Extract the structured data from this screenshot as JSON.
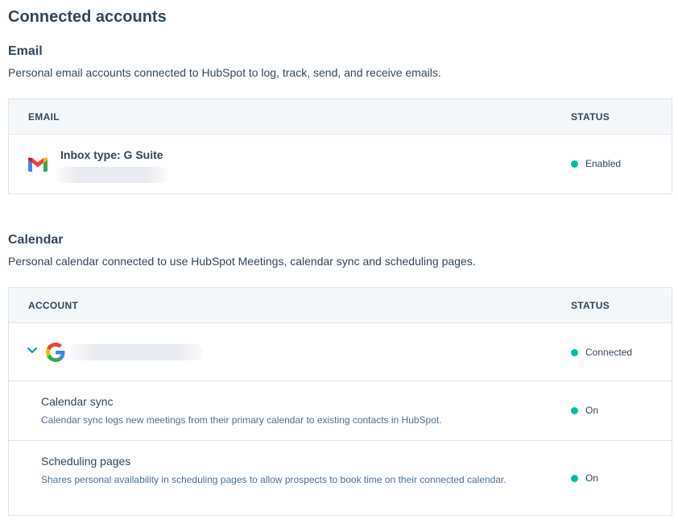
{
  "page": {
    "title": "Connected accounts"
  },
  "email_section": {
    "title": "Email",
    "description": "Personal email accounts connected to HubSpot to log, track, send, and receive emails.",
    "columns": {
      "email": "EMAIL",
      "status": "STATUS"
    },
    "rows": [
      {
        "icon": "gmail-icon",
        "inbox_type": "Inbox type: G Suite",
        "status": "Enabled",
        "status_color": "#00bda5"
      }
    ]
  },
  "calendar_section": {
    "title": "Calendar",
    "description": "Personal calendar connected to use HubSpot Meetings, calendar sync and scheduling pages.",
    "columns": {
      "account": "ACCOUNT",
      "status": "STATUS"
    },
    "account": {
      "icon": "google-icon",
      "status": "Connected",
      "status_color": "#00bda5"
    },
    "features": [
      {
        "title": "Calendar sync",
        "description": "Calendar sync logs new meetings from their primary calendar to existing contacts in HubSpot.",
        "status": "On"
      },
      {
        "title": "Scheduling pages",
        "description": "Shares personal availability in scheduling pages to allow prospects to book time on their connected calendar.",
        "status": "On"
      }
    ]
  },
  "colors": {
    "text": "#33475b",
    "muted": "#516f90",
    "accent": "#0091ae",
    "status_green": "#00bda5",
    "header_bg": "#f5f8fa",
    "border": "#dfe3eb"
  }
}
